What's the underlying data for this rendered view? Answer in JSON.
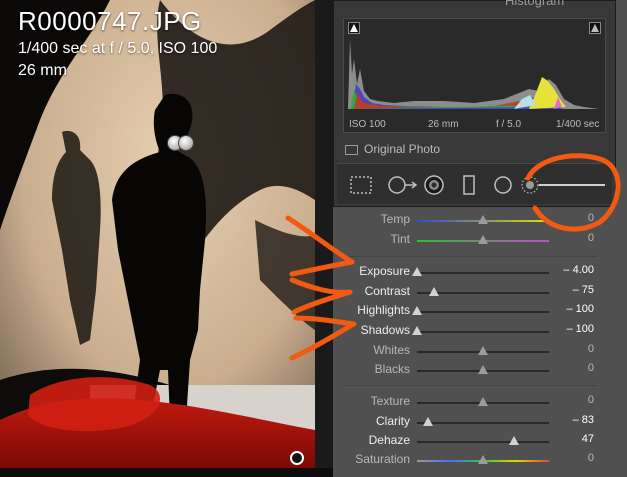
{
  "photo": {
    "filename": "R0000747.JPG",
    "exposure_info": "1/400 sec at f / 5.0, ISO 100",
    "focal_length": "26 mm"
  },
  "histogram": {
    "header": "Histogram",
    "iso": "ISO 100",
    "focal": "26 mm",
    "aperture": "f / 5.0",
    "shutter": "1/400 sec"
  },
  "original_photo_label": "Original Photo",
  "tools": [
    "crop-overlay",
    "spot-removal",
    "red-eye",
    "graduated-filter",
    "radial-filter",
    "adjustment-brush"
  ],
  "sliders_wb": [
    {
      "label": "Temp",
      "value": "0",
      "pos": 0.5,
      "dim": true,
      "track": "temp"
    },
    {
      "label": "Tint",
      "value": "0",
      "pos": 0.5,
      "dim": true,
      "track": "tint"
    }
  ],
  "sliders_tone": [
    {
      "label": "Exposure",
      "value": "– 4.00",
      "pos": 0.0,
      "dim": false
    },
    {
      "label": "Contrast",
      "value": "– 75",
      "pos": 0.125,
      "dim": false
    },
    {
      "label": "Highlights",
      "value": "– 100",
      "pos": 0.0,
      "dim": false
    },
    {
      "label": "Shadows",
      "value": "– 100",
      "pos": 0.0,
      "dim": false
    },
    {
      "label": "Whites",
      "value": "0",
      "pos": 0.5,
      "dim": true
    },
    {
      "label": "Blacks",
      "value": "0",
      "pos": 0.5,
      "dim": true
    }
  ],
  "sliders_presence": [
    {
      "label": "Texture",
      "value": "0",
      "pos": 0.5,
      "dim": true
    },
    {
      "label": "Clarity",
      "value": "– 83",
      "pos": 0.085,
      "dim": false
    },
    {
      "label": "Dehaze",
      "value": "47",
      "pos": 0.735,
      "dim": false
    },
    {
      "label": "Saturation",
      "value": "0",
      "pos": 0.5,
      "dim": true,
      "track": "sat"
    }
  ],
  "annotation_color": "#f25a12"
}
